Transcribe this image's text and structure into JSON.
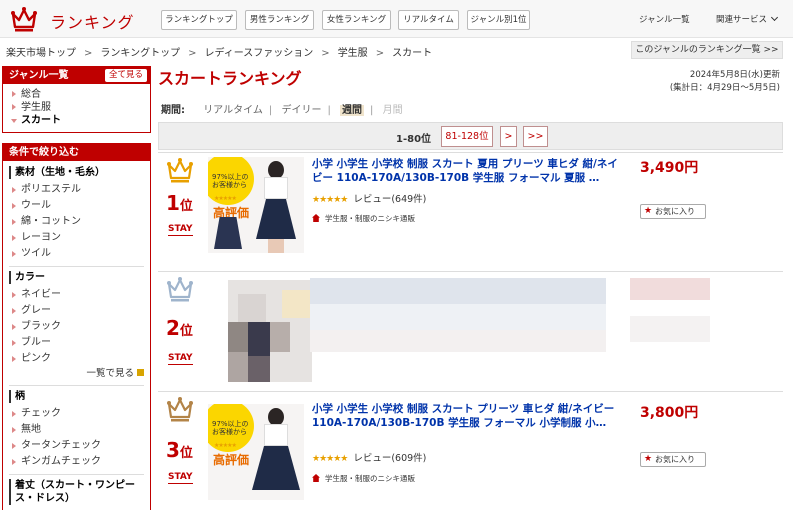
{
  "header": {
    "logo_text": "ランキング",
    "nav_tabs": [
      "ランキングトップ",
      "男性ランキング",
      "女性ランキング",
      "リアルタイム",
      "ジャンル別1位"
    ],
    "genre_list": "ジャンル一覧",
    "related_services": "関連サービス"
  },
  "breadcrumb": [
    "楽天市場トップ",
    "ランキングトップ",
    "レディースファッション",
    "学生服",
    "スカート"
  ],
  "genre_ranking_link": "このジャンルのランキング一覧 >>",
  "sidebar": {
    "genre_title": "ジャンル一覧",
    "show_all": "全て見る",
    "genres": [
      "総合",
      "学生服",
      "スカート"
    ],
    "filter_title": "条件で絞り込む",
    "material_label": "素材（生地・毛糸）",
    "materials": [
      "ポリエステル",
      "ウール",
      "綿・コットン",
      "レーヨン",
      "ツイル"
    ],
    "color_label": "カラー",
    "colors": [
      "ネイビー",
      "グレー",
      "ブラック",
      "ブルー",
      "ピンク"
    ],
    "more": "一覧で見る",
    "pattern_label": "柄",
    "patterns": [
      "チェック",
      "無地",
      "タータンチェック",
      "ギンガムチェック"
    ],
    "length_label": "着丈（スカート・ワンピース・ドレス）"
  },
  "main": {
    "title": "スカートランキング",
    "updated_line1": "2024年5月8日(水)更新",
    "updated_line2": "(集計日：4月29日～5月5日)",
    "period_label": "期間:",
    "periods": [
      "リアルタイム",
      "デイリー",
      "週間",
      "月間"
    ],
    "pager_current": "1-80位",
    "pager_next_range": "81-128位",
    "pager_next": ">",
    "pager_last": ">>"
  },
  "items": [
    {
      "rank": "1",
      "rank_suffix": "位",
      "stay": "STAY",
      "title": "小学 小学生 小学校 制服 スカート 夏用 プリーツ 車ヒダ 紺/ネイビー 110A-170A/130B-170B 学生服 フォーマル 夏服 …",
      "stars": "★★★★★",
      "review": "レビュー(649件)",
      "shop": "学生服・制服のニシキ通販",
      "price": "3,490円",
      "fav": "お気に入り",
      "badge_line1": "97%以上の",
      "badge_line2": "お客様から",
      "badge_hi": "高評価"
    },
    {
      "rank": "2",
      "rank_suffix": "位",
      "stay": "STAY"
    },
    {
      "rank": "3",
      "rank_suffix": "位",
      "stay": "STAY",
      "title": "小学 小学生 小学校 制服 スカート プリーツ 車ヒダ 紺/ネイビー 110A-170A/130B-170B 学生服 フォーマル 小学制服 小…",
      "stars": "★★★★★",
      "review": "レビュー(609件)",
      "shop": "学生服・制服のニシキ通販",
      "price": "3,800円",
      "fav": "お気に入り",
      "badge_line1": "97%以上の",
      "badge_line2": "お客様から",
      "badge_hi": "高評価"
    }
  ],
  "colors": {
    "accent": "#bf0000",
    "gold": "#e8a000",
    "silver": "#9fb4cc",
    "bronze": "#b38448",
    "link": "#0033aa"
  }
}
